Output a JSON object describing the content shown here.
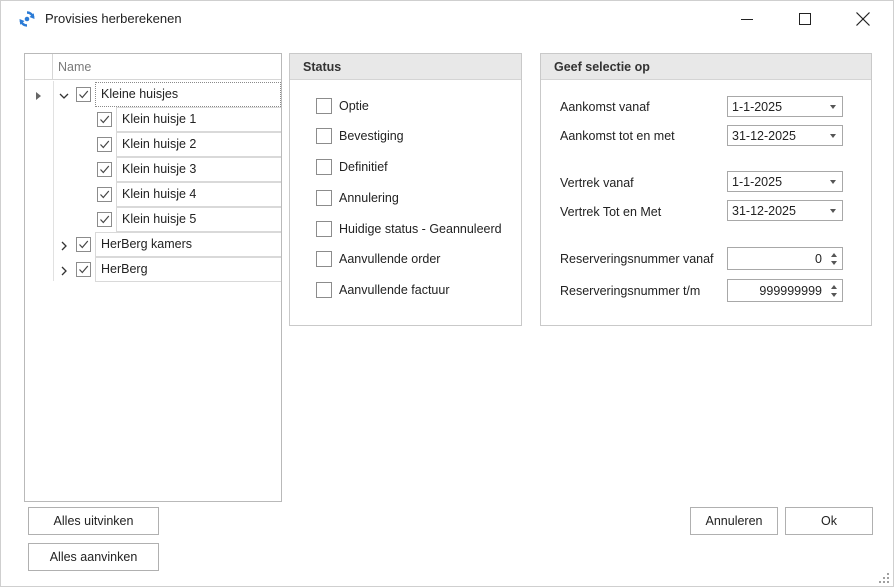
{
  "window": {
    "title": "Provisies herberekenen"
  },
  "tree": {
    "header": "Name",
    "items": [
      {
        "label": "Kleine huisjes",
        "checked": true,
        "expanded": true,
        "level": 0
      },
      {
        "label": "Klein huisje 1",
        "checked": true,
        "level": 1
      },
      {
        "label": "Klein huisje 2",
        "checked": true,
        "level": 1
      },
      {
        "label": "Klein huisje 3",
        "checked": true,
        "level": 1
      },
      {
        "label": "Klein huisje 4",
        "checked": true,
        "level": 1
      },
      {
        "label": "Klein huisje 5",
        "checked": true,
        "level": 1
      },
      {
        "label": "HerBerg kamers",
        "checked": true,
        "expanded": false,
        "level": 0
      },
      {
        "label": "HerBerg",
        "checked": true,
        "expanded": false,
        "level": 0
      }
    ]
  },
  "status": {
    "title": "Status",
    "options": [
      {
        "label": "Optie",
        "checked": false
      },
      {
        "label": "Bevestiging",
        "checked": false
      },
      {
        "label": "Definitief",
        "checked": false
      },
      {
        "label": "Annulering",
        "checked": false
      },
      {
        "label": "Huidige status - Geannuleerd",
        "checked": false
      },
      {
        "label": "Aanvullende order",
        "checked": false
      },
      {
        "label": "Aanvullende factuur",
        "checked": false
      }
    ]
  },
  "selection": {
    "title": "Geef selectie op",
    "arrival_from_label": "Aankomst vanaf",
    "arrival_from_value": "1-1-2025",
    "arrival_to_label": "Aankomst tot en met",
    "arrival_to_value": "31-12-2025",
    "departure_from_label": "Vertrek vanaf",
    "departure_from_value": "1-1-2025",
    "departure_to_label": "Vertrek Tot en Met",
    "departure_to_value": "31-12-2025",
    "resnr_from_label": "Reserveringsnummer vanaf",
    "resnr_from_value": "0",
    "resnr_to_label": "Reserveringsnummer t/m",
    "resnr_to_value": "999999999"
  },
  "buttons": {
    "uncheck_all": "Alles uitvinken",
    "check_all": "Alles aanvinken",
    "cancel": "Annuleren",
    "ok": "Ok"
  },
  "colors": {
    "app_icon": "#2b7bd6",
    "group_header_bg": "#e8e8e8"
  }
}
